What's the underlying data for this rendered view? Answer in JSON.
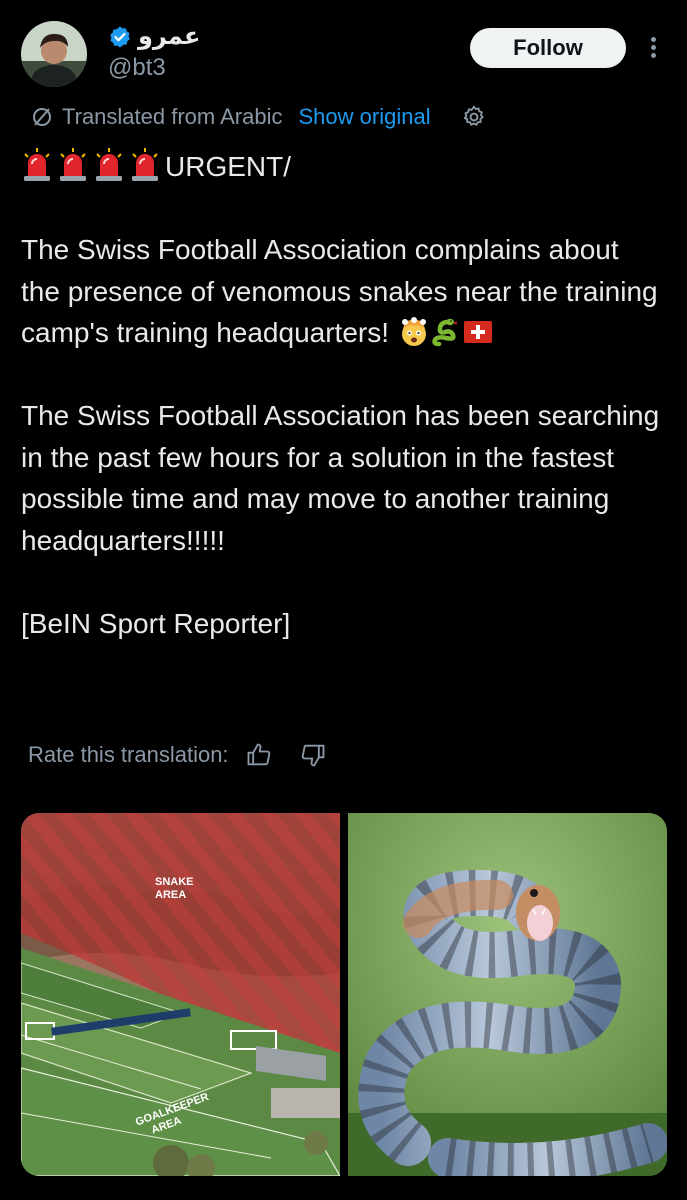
{
  "author": {
    "display_name": "عمرو",
    "handle": "@bt3",
    "verified": true,
    "verified_color": "#1d9bf0"
  },
  "actions": {
    "follow_label": "Follow",
    "more_icon": "more-vertical-icon"
  },
  "translation": {
    "notice": "Translated from Arabic",
    "show_original": "Show original",
    "settings_icon": "gear-icon",
    "rate_label": "Rate this translation:",
    "thumbs_up_icon": "thumbs-up-icon",
    "thumbs_down_icon": "thumbs-down-icon"
  },
  "tweet": {
    "headline": "URGENT/",
    "paragraph1": "The Swiss Football Association complains about the presence of venomous snakes near the training camp's training headquarters!",
    "paragraph2": "The Swiss Football Association has been searching in the past few hours for a solution in the fastest possible time and may move to another training headquarters!!!!!",
    "source": "[BeIN Sport Reporter]"
  },
  "media": {
    "left_labels": {
      "snake_area": "SNAKE AREA",
      "goalkeeper_area": "GOALKEEPER AREA"
    }
  },
  "colors": {
    "background": "#000000",
    "text": "#e7e9ea",
    "muted": "#8b98a5",
    "link": "#1d9bf0"
  }
}
